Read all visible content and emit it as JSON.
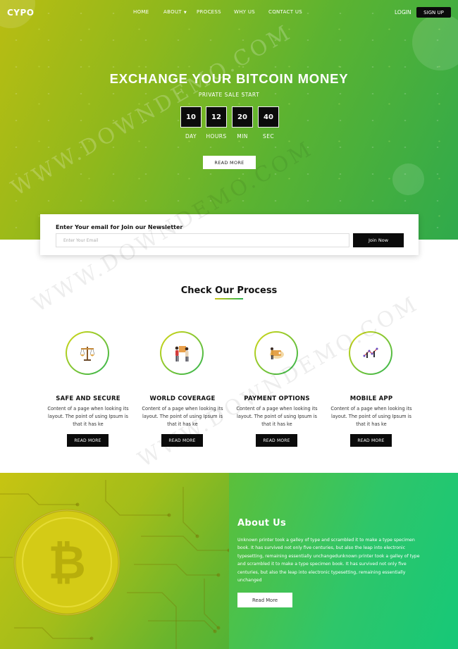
{
  "brand": {
    "logo": "CYPO"
  },
  "nav": {
    "items": [
      {
        "label": "HOME"
      },
      {
        "label": "ABOUT"
      },
      {
        "label": "PROCESS"
      },
      {
        "label": "WHY US"
      },
      {
        "label": "CONTACT US"
      }
    ],
    "login": "LOGIN",
    "signup": "SIGN UP"
  },
  "hero": {
    "title": "EXCHANGE YOUR BITCOIN MONEY",
    "subtitle": "PRIVATE SALE START",
    "countdown": [
      {
        "value": "10",
        "label": "DAY"
      },
      {
        "value": "12",
        "label": "HOURS"
      },
      {
        "value": "20",
        "label": "MIN"
      },
      {
        "value": "40",
        "label": "SEC"
      }
    ],
    "button": "READ MORE"
  },
  "newsletter": {
    "title": "Enter Your email for Join our Newsletter",
    "placeholder": "Enter Your Email",
    "value": "",
    "button": "Join Now"
  },
  "process": {
    "title": "Check Our Process",
    "features": [
      {
        "title": "SAFE AND SECURE",
        "text": "Content of a page when looking its layout. The point of using Ipsum is that it has ke",
        "button": "READ MORE",
        "icon": "scales-icon"
      },
      {
        "title": "WORLD COVERAGE",
        "text": "Content of a page when looking its layout. The point of using Ipsum is that it has ke",
        "button": "READ MORE",
        "icon": "people-icon"
      },
      {
        "title": "PAYMENT OPTIONS",
        "text": "Content of a page when looking its layout. The point of using Ipsum is that it has ke",
        "button": "READ MORE",
        "icon": "payment-icon"
      },
      {
        "title": "MOBILE APP",
        "text": "Content of a page when looking its layout. The point of using Ipsum is that it has ke",
        "button": "READ MORE",
        "icon": "mobile-icon"
      }
    ]
  },
  "about": {
    "title": "About Us",
    "text": "Unknown printer took a galley of type and scrambled it to make a type specimen book. It has survived not only five centuries, but also the leap into electronic typesetting, remaining essentially unchangedunknown printer took a galley of type and scrambled it to make a type specimen book. It has survived not only five centuries, but also the leap into electronic typesetting, remaining essentially unchanged",
    "button": "Read More"
  },
  "watermark": "WWW.DOWNDEMO.COM",
  "colors": {
    "hero_start": "#b9bd12",
    "hero_end": "#2faa4c",
    "about_panel": "#16c878",
    "button_dark": "#0b0b0b"
  }
}
